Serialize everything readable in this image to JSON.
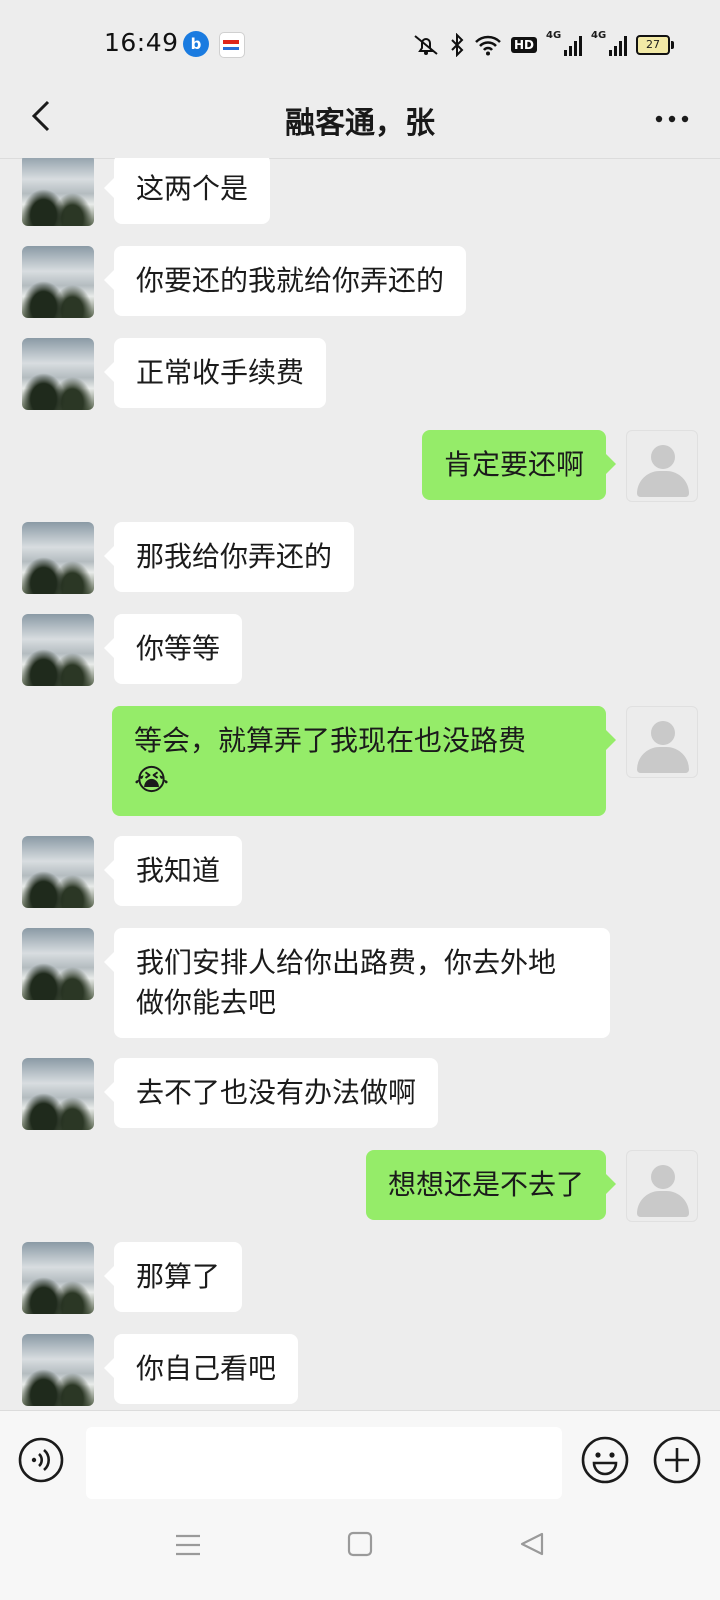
{
  "status_bar": {
    "time": "16:49",
    "app_icon_1": "browser-app-icon",
    "app_icon_2": "news-app-icon",
    "icons": [
      "mute-icon",
      "bluetooth-icon",
      "wifi-icon",
      "hd-voice-icon",
      "signal-4g-icon",
      "signal-4g-icon",
      "battery-icon"
    ],
    "hd_label": "HD",
    "network_label": "4G",
    "battery_level": "27"
  },
  "header": {
    "title": "融客通，张"
  },
  "messages": [
    {
      "side": "in",
      "text": "这两个是"
    },
    {
      "side": "in",
      "text": "你要还的我就给你弄还的"
    },
    {
      "side": "in",
      "text": "正常收手续费"
    },
    {
      "side": "out",
      "text": "肯定要还啊"
    },
    {
      "side": "in",
      "text": "那我给你弄还的"
    },
    {
      "side": "in",
      "text": "你等等"
    },
    {
      "side": "out",
      "text": "等会，就算弄了我现在也没路费",
      "emoji": "😭"
    },
    {
      "side": "in",
      "text": "我知道"
    },
    {
      "side": "in",
      "text": "我们安排人给你出路费，你去外地",
      "text2": "做你能去吧"
    },
    {
      "side": "in",
      "text": "去不了也没有办法做啊"
    },
    {
      "side": "out",
      "text": "想想还是不去了"
    },
    {
      "side": "in",
      "text": "那算了"
    },
    {
      "side": "in",
      "text": "你自己看吧"
    }
  ],
  "input_bar": {
    "placeholder": "",
    "icons": [
      "voice-icon",
      "emoji-icon",
      "plus-icon"
    ]
  },
  "nav_bar": {
    "icons": [
      "menu-icon",
      "home-icon",
      "back-icon"
    ]
  },
  "colors": {
    "background": "#ededed",
    "incoming_bubble": "#ffffff",
    "outgoing_bubble": "#95ec69"
  }
}
